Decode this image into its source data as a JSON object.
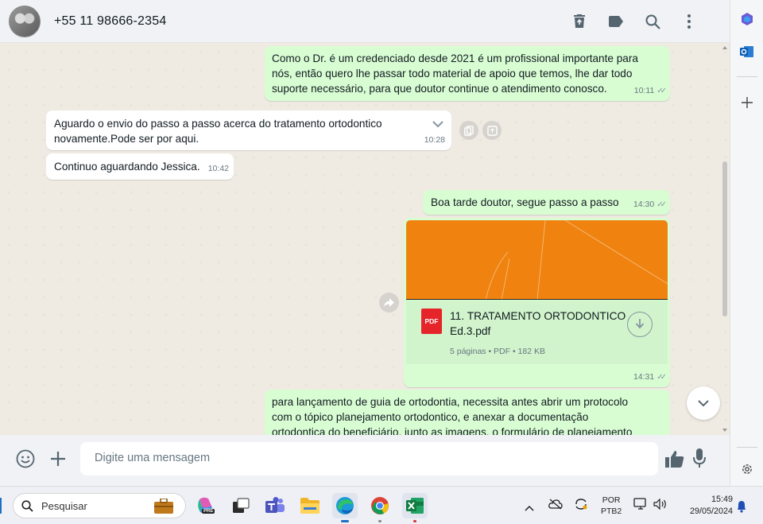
{
  "header": {
    "contact_name": "+55 11 98666-2354"
  },
  "messages": [
    {
      "direction": "out",
      "lines": [
        "Como o Dr. é um credenciado desde 2021 é um profissional importante para",
        "nós, então quero lhe passar todo material de apoio que temos, lhe dar todo",
        "suporte necessário, para que doutor continue o atendimento conosco."
      ],
      "time": "10:11"
    },
    {
      "direction": "in",
      "lines": [
        "Aguardo o envio do passo a passo acerca do tratamento ortodontico",
        "novamente.Pode ser por aqui."
      ],
      "time": "10:28"
    },
    {
      "direction": "in",
      "lines": [
        "Continuo aguardando Jessica."
      ],
      "time": "10:42"
    },
    {
      "direction": "out",
      "lines": [
        "Boa tarde doutor, segue passo a passo"
      ],
      "time": "14:30"
    },
    {
      "direction": "out",
      "type": "document",
      "file_name_lines": [
        "11. TRATAMENTO ORTODONTICO",
        "Ed.3.pdf"
      ],
      "file_icon_label": "PDF",
      "file_meta": "5 páginas • PDF • 182 KB",
      "time": "14:31"
    },
    {
      "direction": "out",
      "lines": [
        "para lançamento de guia de ortodontia, necessita antes abrir um protocolo",
        "com o tópico planejamento ortodontico, e anexar a documentação",
        "ortodontica do beneficiário, junto as imagens, o formulário de planejamento"
      ]
    }
  ],
  "compose": {
    "placeholder": "Digite uma mensagem"
  },
  "taskbar": {
    "search_label": "Pesquisar",
    "lang_top": "POR",
    "lang_bottom": "PTB2",
    "time": "15:49",
    "date": "29/05/2024",
    "copilot_badge": "PRE"
  },
  "colors": {
    "outgoing_bubble": "#d9fdd3",
    "incoming_bubble": "#ffffff",
    "chat_background": "#efeae2",
    "header_background": "#f0f2f5",
    "document_preview": "#f0820f",
    "pdf_icon": "#e5252a"
  }
}
